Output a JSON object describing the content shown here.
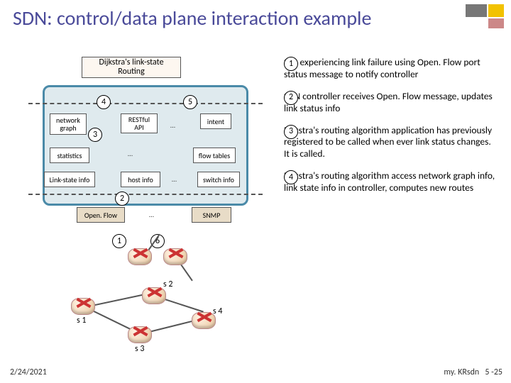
{
  "title": "SDN: control/data plane interaction example",
  "diagram": {
    "dijkstra": "Dijkstra's link-state\nRouting",
    "network_graph": "network graph",
    "restful": "RESTful API",
    "intent": "intent",
    "statistics": "statistics",
    "flow_tables": "flow tables",
    "link_state": "Link-state info",
    "host_info": "host info",
    "switch_info": "switch info",
    "openflow": "Open. Flow",
    "snmp": "SNMP",
    "markers": {
      "m1": "1",
      "m2": "2",
      "m3": "3",
      "m4": "4",
      "m5": "5",
      "m6": "6"
    },
    "switches": {
      "s1": "s 1",
      "s2": "s 2",
      "s3": "s 3",
      "s4": "s 4"
    }
  },
  "steps": [
    {
      "n": "1",
      "text": "S 1, experiencing link failure using Open. Flow port status message to notify controller"
    },
    {
      "n": "2",
      "text": "SDN controller receives Open. Flow message, updates link status info"
    },
    {
      "n": "3",
      "text": "Dijkstra's routing algorithm application has previously registered to be called when ever link status changes. It is called."
    },
    {
      "n": "4",
      "text": "Dijkstra's routing algorithm access network graph info, link state info in controller, computes new routes"
    }
  ],
  "footer": {
    "left": "2/24/2021",
    "right_a": "my. KRsdn",
    "right_b": "5 -25"
  }
}
